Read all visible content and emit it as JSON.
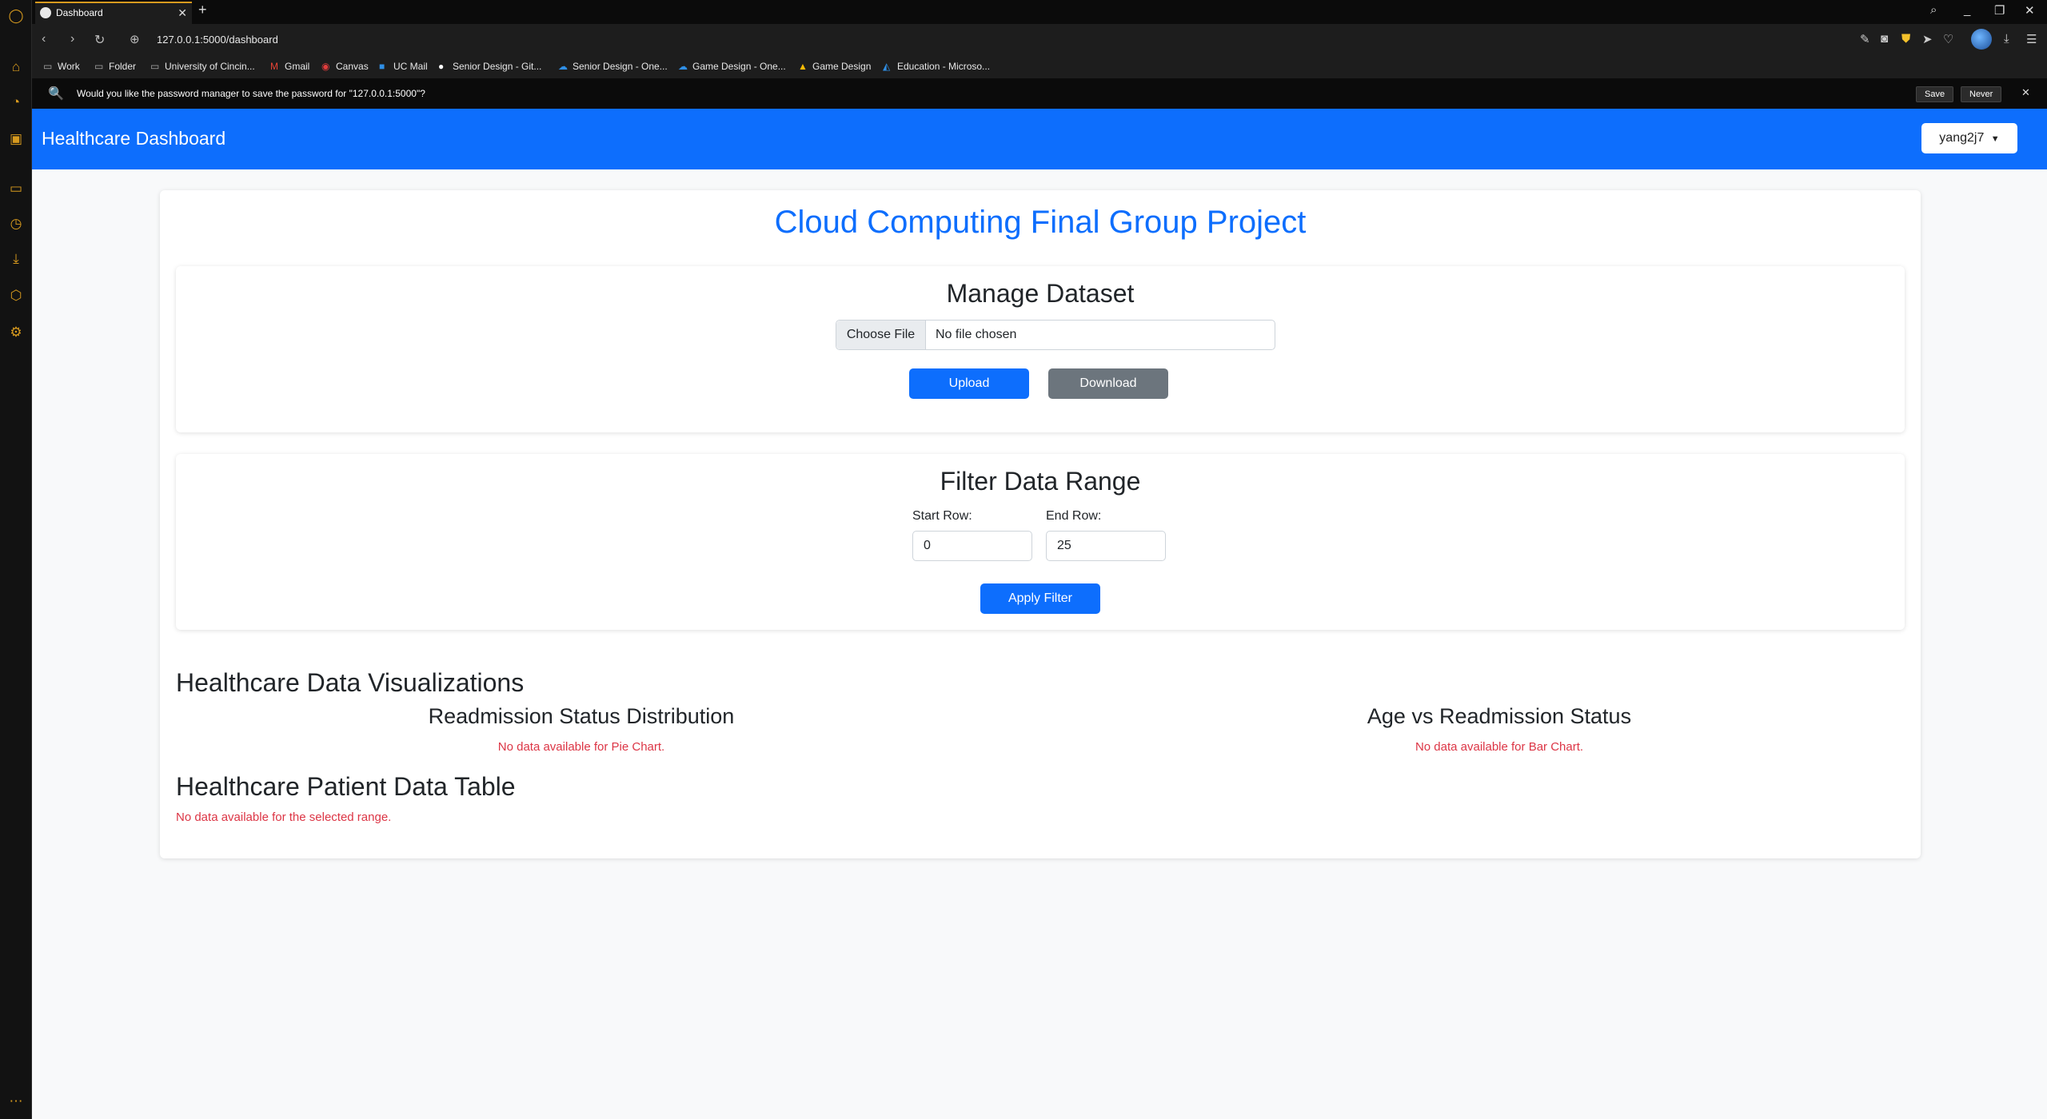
{
  "browser": {
    "tab_title": "Dashboard",
    "url": "127.0.0.1:5000/dashboard",
    "bookmarks": [
      {
        "label": "Work",
        "icon": "folder-icon"
      },
      {
        "label": "Folder",
        "icon": "folder-icon"
      },
      {
        "label": "University of Cincin...",
        "icon": "folder-icon"
      },
      {
        "label": "Gmail",
        "icon": "gmail-icon"
      },
      {
        "label": "Canvas",
        "icon": "canvas-icon"
      },
      {
        "label": "UC Mail",
        "icon": "outlook-icon"
      },
      {
        "label": "Senior Design - Git...",
        "icon": "github-icon"
      },
      {
        "label": "Senior Design - One...",
        "icon": "onedrive-icon"
      },
      {
        "label": "Game Design - One...",
        "icon": "onedrive-icon"
      },
      {
        "label": "Game Design",
        "icon": "google-drive-icon"
      },
      {
        "label": "Education - Microso...",
        "icon": "azure-icon"
      }
    ],
    "password_prompt": {
      "text": "Would you like the password manager to save the password for \"127.0.0.1:5000\"?",
      "save_label": "Save",
      "never_label": "Never"
    }
  },
  "app": {
    "brand": "Healthcare Dashboard",
    "user_menu": "yang2j7",
    "page_title": "Cloud Computing Final Group Project",
    "manage": {
      "title": "Manage Dataset",
      "choose_file_label": "Choose File",
      "file_status": "No file chosen",
      "upload_label": "Upload",
      "download_label": "Download"
    },
    "filter": {
      "title": "Filter Data Range",
      "start_label": "Start Row:",
      "start_value": "0",
      "end_label": "End Row:",
      "end_value": "25",
      "apply_label": "Apply Filter"
    },
    "visualizations": {
      "title": "Healthcare Data Visualizations",
      "pie_title": "Readmission Status Distribution",
      "pie_empty": "No data available for Pie Chart.",
      "bar_title": "Age vs Readmission Status",
      "bar_empty": "No data available for Bar Chart."
    },
    "table": {
      "title": "Healthcare Patient Data Table",
      "empty": "No data available for the selected range."
    }
  },
  "colors": {
    "primary": "#0d6efd",
    "secondary": "#6c757d",
    "danger": "#dc3545",
    "browser_accent": "#d79a1e"
  }
}
